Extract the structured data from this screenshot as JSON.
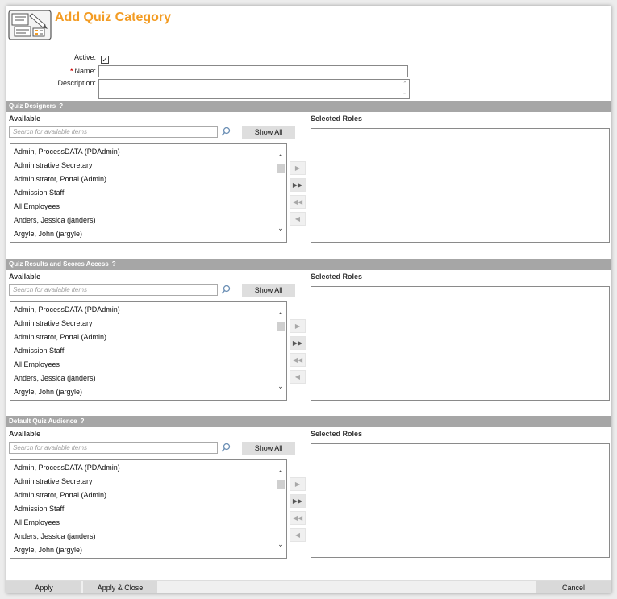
{
  "page": {
    "title": "Add Quiz Category"
  },
  "form": {
    "active_label": "Active:",
    "active_checked": true,
    "active_checkmark": "✓",
    "required_mark": "*",
    "name_label": "Name:",
    "name_value": "",
    "description_label": "Description:",
    "description_value": ""
  },
  "sections": [
    {
      "title": "Quiz Designers",
      "help": "?",
      "available_label": "Available",
      "selected_label": "Selected Roles",
      "search_placeholder": "Search for available items",
      "show_all_label": "Show All",
      "items": [
        "Admin, ProcessDATA (PDAdmin)",
        "Administrative Secretary",
        "Administrator, Portal (Admin)",
        "Admission Staff",
        "All Employees",
        "Anders, Jessica (janders)",
        "Argyle, John (jargyle)"
      ]
    },
    {
      "title": "Quiz Results and Scores Access",
      "help": "?",
      "available_label": "Available",
      "selected_label": "Selected Roles",
      "search_placeholder": "Search for available items",
      "show_all_label": "Show All",
      "items": [
        "Admin, ProcessDATA (PDAdmin)",
        "Administrative Secretary",
        "Administrator, Portal (Admin)",
        "Admission Staff",
        "All Employees",
        "Anders, Jessica (janders)",
        "Argyle, John (jargyle)"
      ]
    },
    {
      "title": "Default Quiz Audience",
      "help": "?",
      "available_label": "Available",
      "selected_label": "Selected Roles",
      "search_placeholder": "Search for available items",
      "show_all_label": "Show All",
      "items": [
        "Admin, ProcessDATA (PDAdmin)",
        "Administrative Secretary",
        "Administrator, Portal (Admin)",
        "Admission Staff",
        "All Employees",
        "Anders, Jessica (janders)",
        "Argyle, John (jargyle)"
      ]
    }
  ],
  "transfer_glyphs": {
    "move_right": "▶",
    "move_all_right": "▶▶",
    "move_all_left": "◀◀",
    "move_left": "◀"
  },
  "scroll_glyphs": {
    "up": "⌃",
    "down": "⌄"
  },
  "footer": {
    "apply_label": "Apply",
    "apply_close_label": "Apply & Close",
    "cancel_label": "Cancel"
  },
  "colors": {
    "title": "#f39c24",
    "section_bar": "#a6a6a6",
    "required": "#cc0000"
  },
  "icons": {
    "logo": "quiz-category-logo-icon",
    "search": "magnifier-icon",
    "help": "help-icon"
  }
}
